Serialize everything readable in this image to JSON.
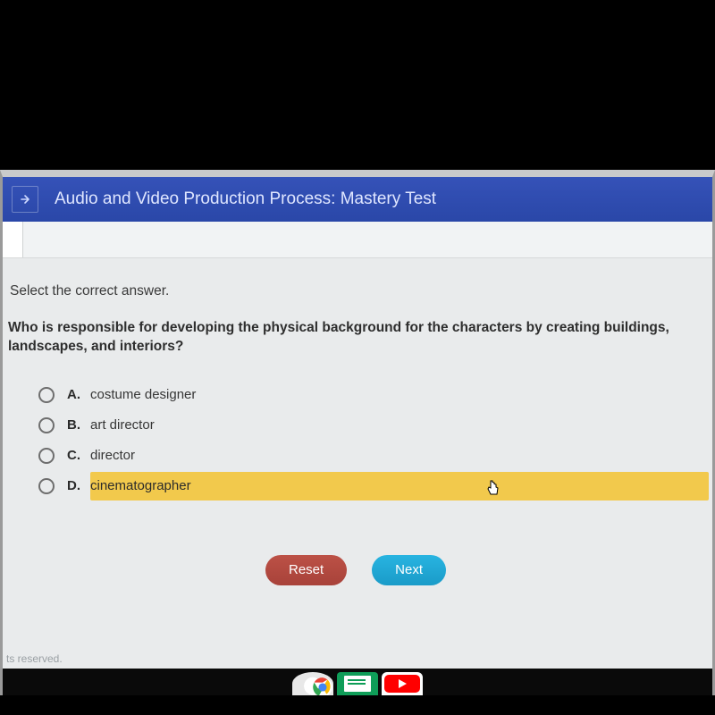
{
  "header": {
    "title": "Audio and Video Production Process: Mastery Test"
  },
  "instruction": "Select the correct answer.",
  "question": "Who is responsible for developing the physical background for the characters by creating buildings, landscapes, and interiors?",
  "options": {
    "A": {
      "letter": "A.",
      "text": "costume designer"
    },
    "B": {
      "letter": "B.",
      "text": "art director"
    },
    "C": {
      "letter": "C.",
      "text": "director"
    },
    "D": {
      "letter": "D.",
      "text": "cinematographer"
    }
  },
  "buttons": {
    "reset": "Reset",
    "next": "Next"
  },
  "footer": "ts reserved."
}
